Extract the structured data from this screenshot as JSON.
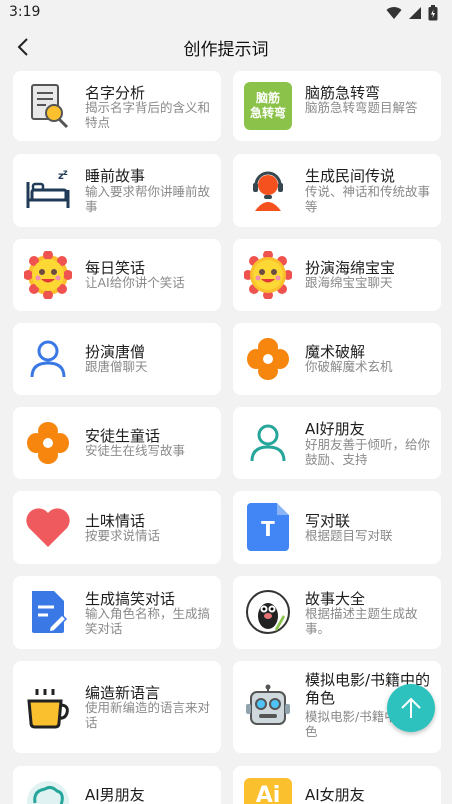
{
  "status": {
    "time": "3:19"
  },
  "header": {
    "title": "创作提示词"
  },
  "cards": [
    {
      "title": "名字分析",
      "desc": "揭示名字背后的含义和特点",
      "icon": "name-analysis-icon"
    },
    {
      "title": "脑筋急转弯",
      "desc": "脑筋急转弯题目解答",
      "icon": "brain-teaser-icon",
      "icon_text": "脑筋急转弯"
    },
    {
      "title": "睡前故事",
      "desc": "输入要求帮你讲睡前故事",
      "icon": "bed-icon"
    },
    {
      "title": "生成民间传说",
      "desc": "传说、神话和传统故事等",
      "icon": "headset-agent-icon"
    },
    {
      "title": "每日笑话",
      "desc": "让AI给你讲个笑话",
      "icon": "sun-face-icon"
    },
    {
      "title": "扮演海绵宝宝",
      "desc": "跟海绵宝宝聊天",
      "icon": "sun-face-icon"
    },
    {
      "title": "扮演唐僧",
      "desc": "跟唐僧聊天",
      "icon": "user-outline-icon"
    },
    {
      "title": "魔术破解",
      "desc": "你破解魔术玄机",
      "icon": "orange-flower-icon"
    },
    {
      "title": "安徒生童话",
      "desc": "安徒生在线写故事",
      "icon": "orange-flower-icon"
    },
    {
      "title": "AI好朋友",
      "desc": "好朋友善于倾听，给你鼓励、支持",
      "icon": "user-outline-icon"
    },
    {
      "title": "土味情话",
      "desc": "按要求说情话",
      "icon": "heart-icon"
    },
    {
      "title": "写对联",
      "desc": "根据题目写对联",
      "icon": "document-t-icon",
      "icon_text": "T"
    },
    {
      "title": "生成搞笑对话",
      "desc": "输入角色名称，生成搞笑对话",
      "icon": "edit-document-icon"
    },
    {
      "title": "故事大全",
      "desc": "根据描述主题生成故事。",
      "icon": "mole-avatar-icon"
    },
    {
      "title": "编造新语言",
      "desc": "使用新编造的语言来对话",
      "icon": "coffee-cup-icon"
    },
    {
      "title": "模拟电影/书籍中的角色",
      "desc": "模拟电影/书籍中的角色",
      "icon": "robot-icon"
    },
    {
      "title": "AI男朋友",
      "desc": "",
      "icon": "brain-icon"
    },
    {
      "title": "AI女朋友",
      "desc": "",
      "icon": "ai-badge-icon",
      "icon_text": "Ai"
    }
  ],
  "colors": {
    "accent": "#2dc2be",
    "orange": "#f7860f",
    "blue": "#3a78e6",
    "teal": "#26a69a",
    "heart": "#ef5a5f",
    "sun": "#fbc02d"
  }
}
